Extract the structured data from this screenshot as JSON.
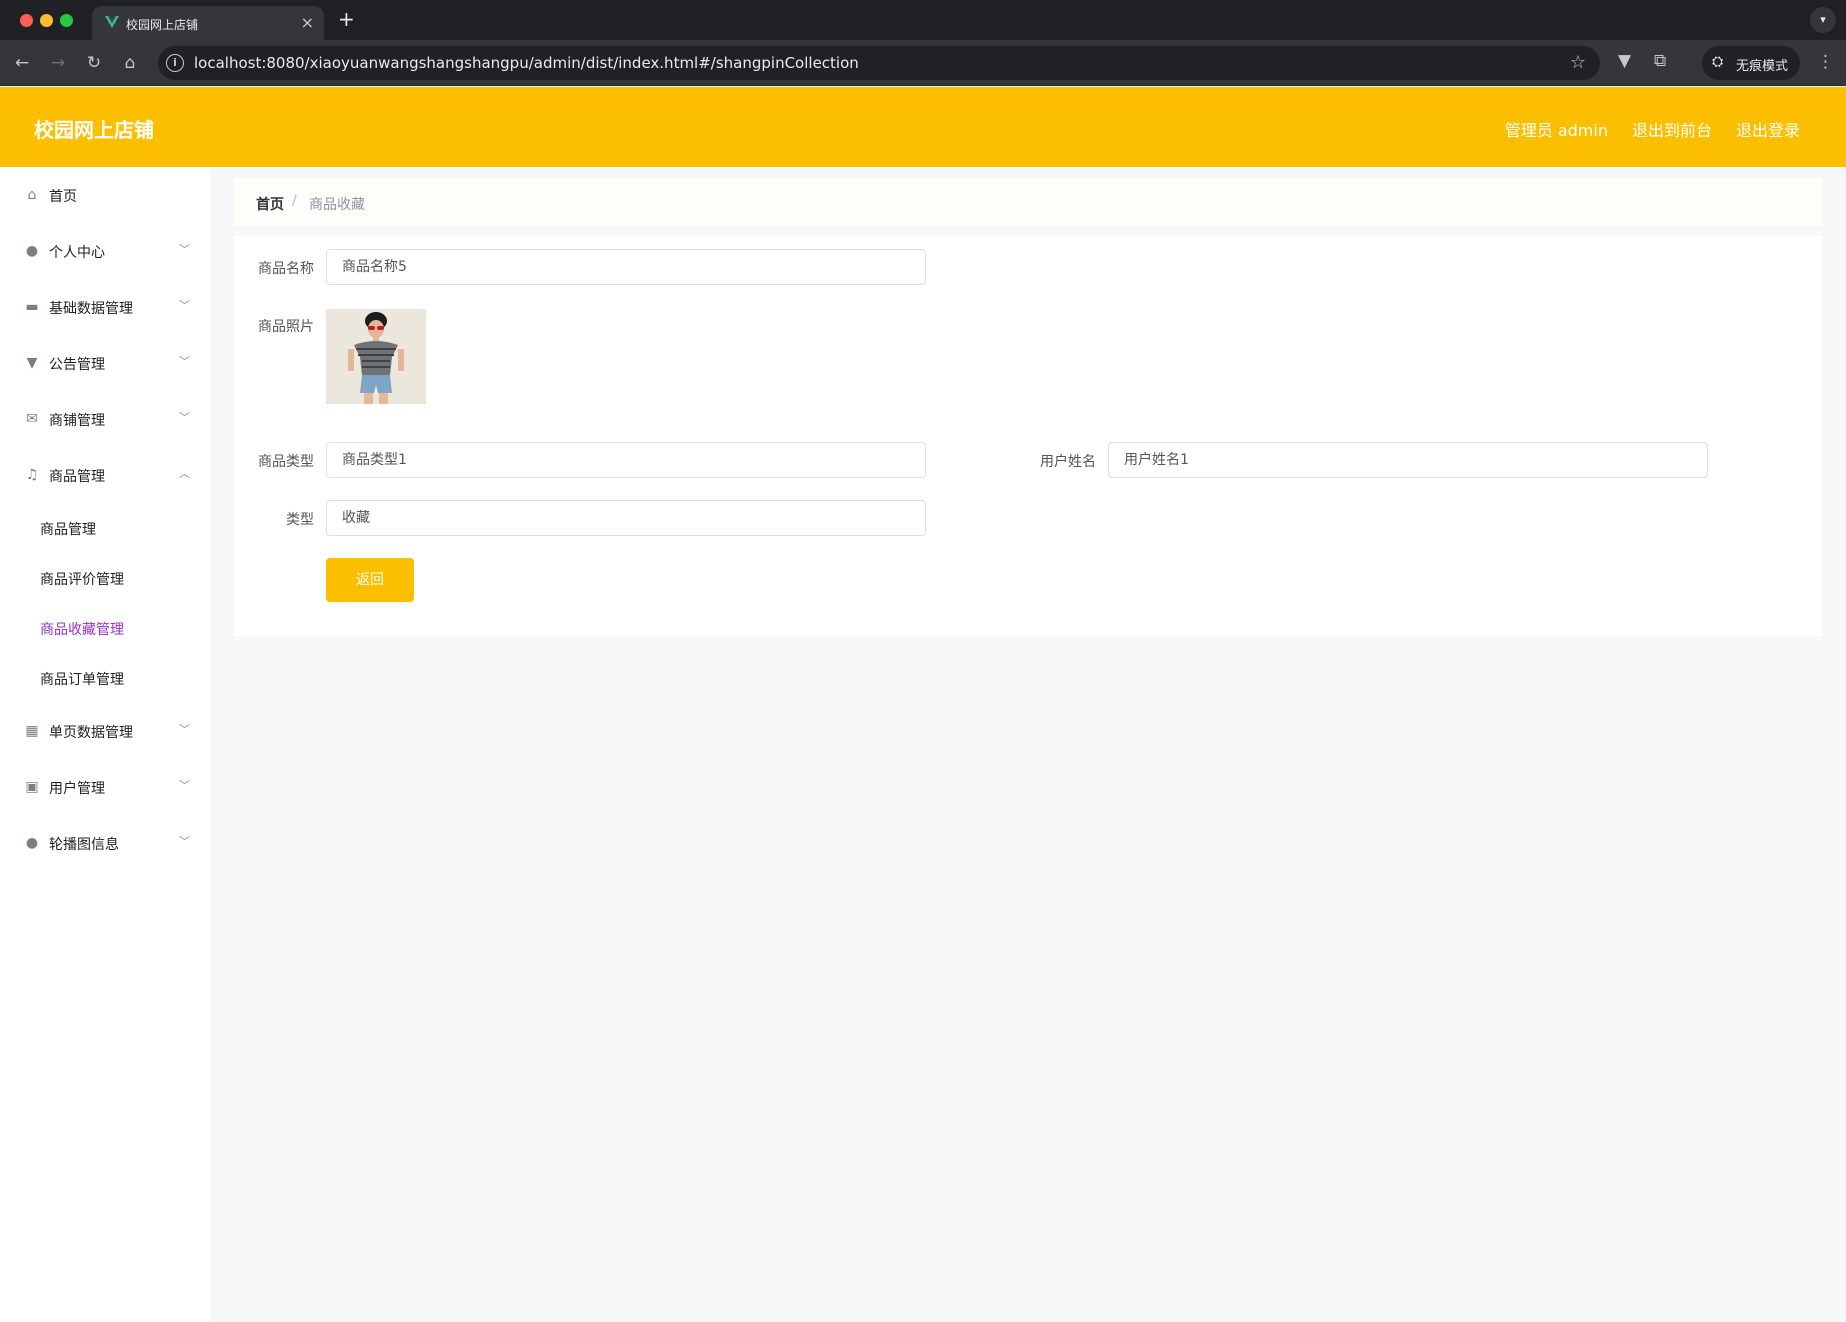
{
  "browser": {
    "tab_title": "校园网上店铺",
    "new_tab": "+",
    "tab_close": "×",
    "url": "localhost:8080/xiaoyuanwangshangshangpu/admin/dist/index.html#/shangpinCollection",
    "incognito_label": "无痕模式"
  },
  "header": {
    "title": "校园网上店铺",
    "admin_label": "管理员 admin",
    "to_frontend": "退出到前台",
    "logout": "退出登录"
  },
  "sidebar": {
    "items": [
      {
        "label": "首页",
        "icon": "home-icon"
      },
      {
        "label": "个人中心",
        "icon": "user-icon"
      },
      {
        "label": "基础数据管理",
        "icon": "monitor-icon"
      },
      {
        "label": "公告管理",
        "icon": "brush-icon"
      },
      {
        "label": "商铺管理",
        "icon": "mail-icon"
      },
      {
        "label": "商品管理",
        "icon": "microphone-icon"
      },
      {
        "label": "单页数据管理",
        "icon": "grid-icon"
      },
      {
        "label": "用户管理",
        "icon": "clipboard-icon"
      },
      {
        "label": "轮播图信息",
        "icon": "user-icon"
      }
    ],
    "sub_items": [
      {
        "label": "商品管理"
      },
      {
        "label": "商品评价管理"
      },
      {
        "label": "商品收藏管理",
        "active": true
      },
      {
        "label": "商品订单管理"
      }
    ]
  },
  "breadcrumb": {
    "home": "首页",
    "separator": "/",
    "current": "商品收藏"
  },
  "form": {
    "name_label": "商品名称",
    "name_value": "商品名称5",
    "photo_label": "商品照片",
    "type_label": "商品类型",
    "type_value": "商品类型1",
    "user_label": "用户姓名",
    "user_value": "用户姓名1",
    "kind_label": "类型",
    "kind_value": "收藏",
    "back_button": "返回"
  },
  "colors": {
    "header": "#fcbf00",
    "active_menu": "#9b30d9"
  }
}
